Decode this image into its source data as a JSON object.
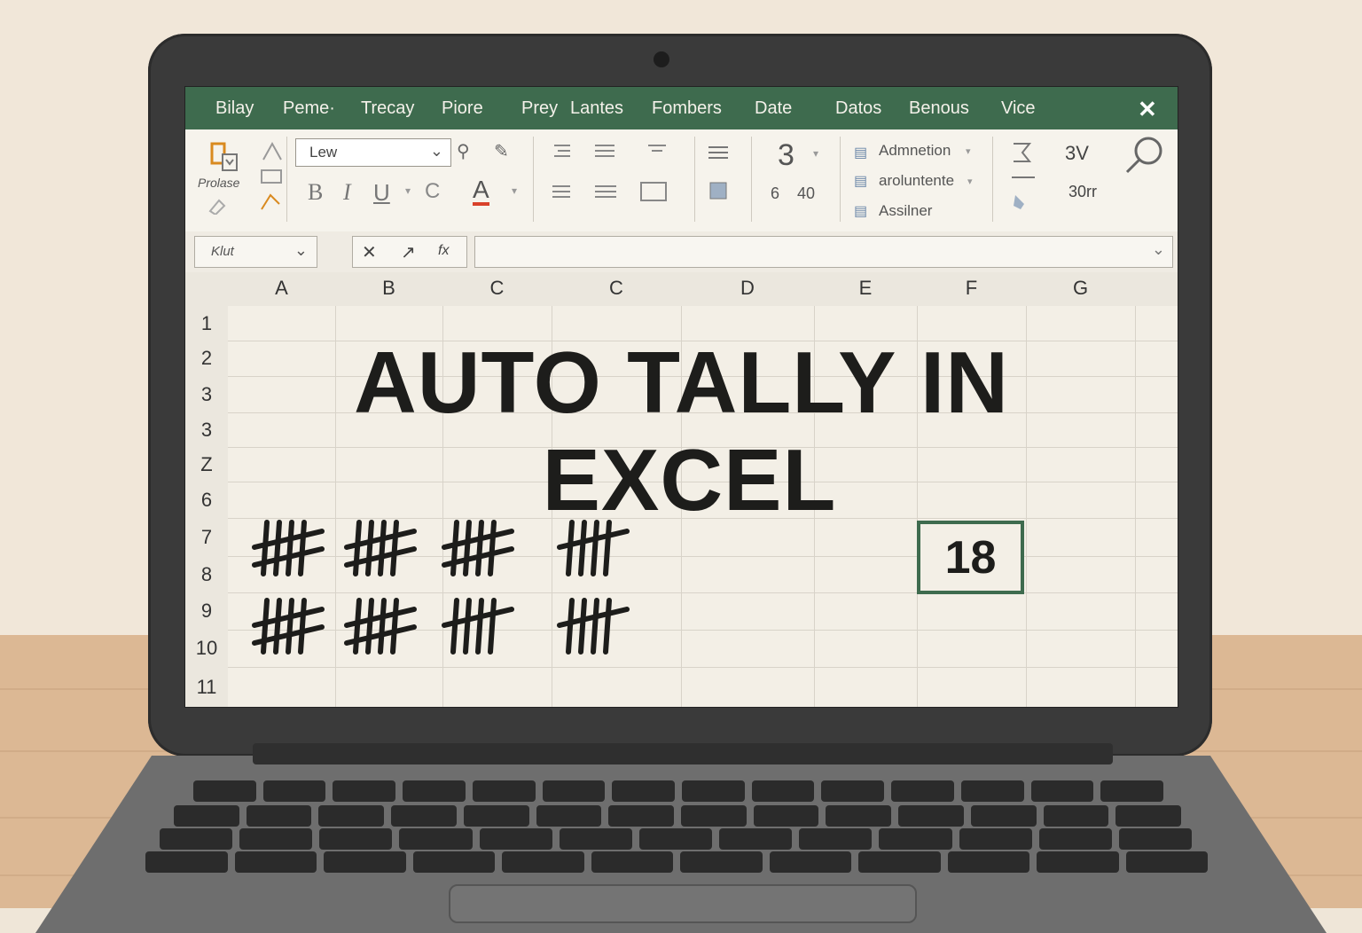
{
  "menubar": {
    "items": [
      "Bilay",
      "Peme·",
      "Trecay",
      "Piore",
      "Prey",
      "Lantes",
      "Fombers",
      "Date",
      "Datos",
      "Benous",
      "Vice"
    ],
    "close": "✕"
  },
  "ribbon": {
    "paste_label": "Prolase",
    "font_name": "Lew",
    "bold": "B",
    "italic": "I",
    "underline": "U",
    "strike": "C",
    "font_color": "A",
    "number_top": "3",
    "number_a": "6",
    "number_b": "40",
    "styles": [
      "Admnetion",
      "aroluntente",
      "Assilner"
    ],
    "sigma": "3V",
    "sort": "30rr"
  },
  "formula_bar": {
    "name_box": "Klut",
    "cancel": "✕",
    "enter": "↗",
    "fx": "fx",
    "value": ""
  },
  "sheet": {
    "columns": [
      "A",
      "B",
      "C",
      "C",
      "D",
      "E",
      "F",
      "G"
    ],
    "rows": [
      "1",
      "2",
      "3",
      "3",
      "Z",
      "6",
      "7",
      "8",
      "9",
      "10",
      "11"
    ],
    "title_line1": "AUTO TALLY IN",
    "title_line2": "EXCEL",
    "result_value": "18",
    "tallies": {
      "row1": [
        5,
        5,
        5,
        4
      ],
      "row2": [
        5,
        5,
        4,
        4
      ]
    }
  },
  "colors": {
    "accent": "#3e6b4e",
    "screen_bg": "#f3efe6",
    "ink": "#1d1d1b"
  }
}
